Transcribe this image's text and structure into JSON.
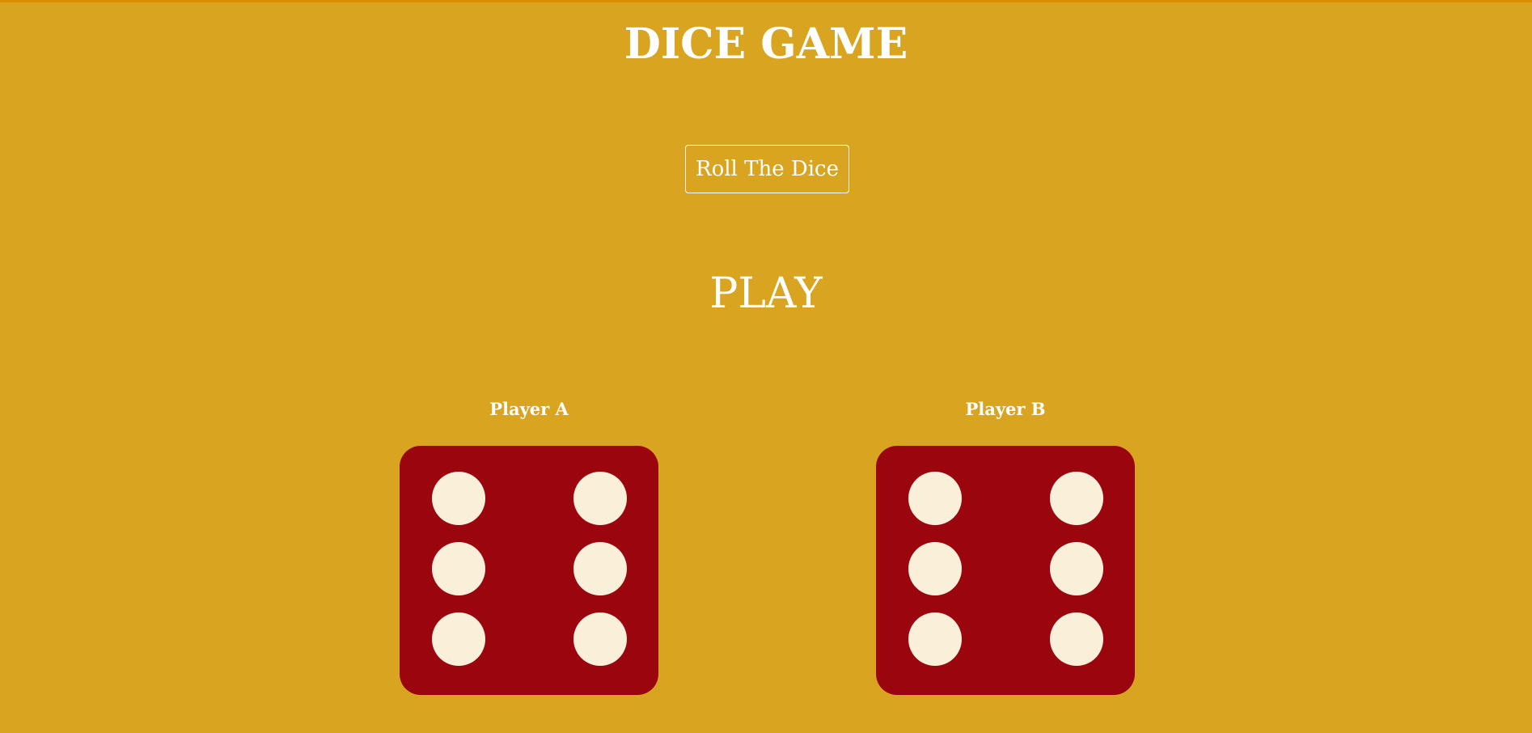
{
  "page": {
    "title": "DICE GAME",
    "roll_button_label": "Roll The Dice",
    "status_text": "PLAY"
  },
  "players": [
    {
      "name": "Player A",
      "die_value": 6
    },
    {
      "name": "Player B",
      "die_value": 6
    }
  ],
  "colors": {
    "background": "#D9A520",
    "die_face": "#9A050E",
    "pip": "#FAEFD9",
    "text": "#FFFFFF"
  }
}
